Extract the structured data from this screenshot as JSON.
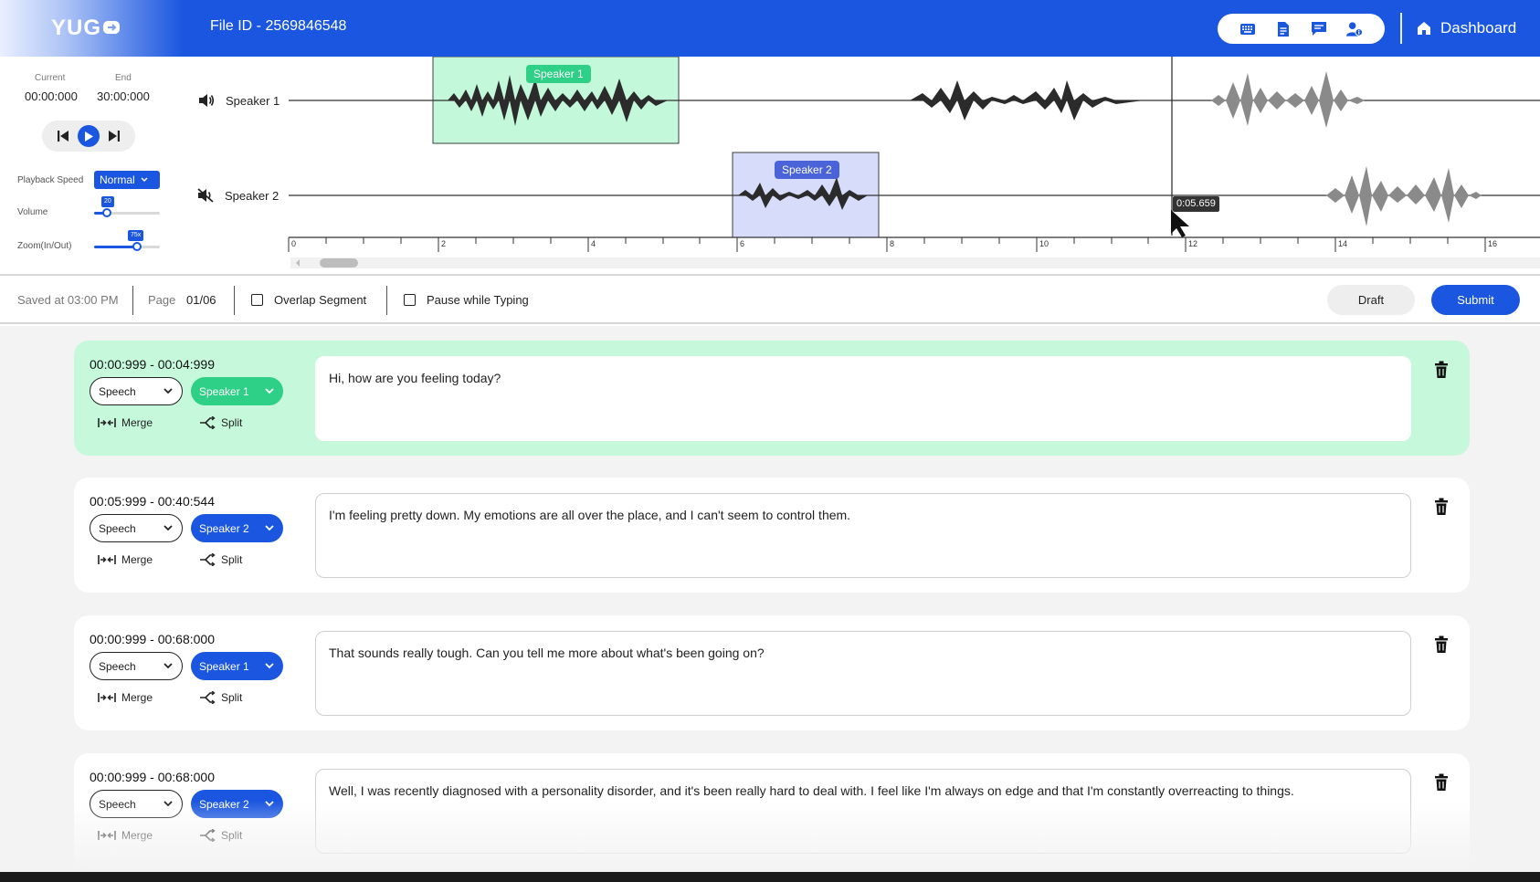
{
  "header": {
    "logo": "YUG",
    "file_id": "File ID - 2569846548",
    "icons": [
      "keyboard-icon",
      "document-icon",
      "comment-icon",
      "user-info-icon"
    ],
    "dashboard_label": "Dashboard"
  },
  "player": {
    "current_label": "Current",
    "current_value": "00:00:000",
    "end_label": "End",
    "end_value": "30:00:000",
    "playback_speed_label": "Playback Speed",
    "playback_speed_value": "Normal",
    "volume_label": "Volume",
    "volume_value": "20",
    "volume_level": 0.2,
    "zoom_label": "Zoom(In/Out)",
    "zoom_value": "75x",
    "zoom_level": 0.75
  },
  "waveform": {
    "speaker1_label": "Speaker 1",
    "speaker2_label": "Speaker 2",
    "speaker1_badge": "Speaker 1",
    "speaker2_badge": "Speaker 2",
    "cursor_time": "0:05.659",
    "ruler_labels": [
      "0",
      "2",
      "4",
      "6",
      "8",
      "10",
      "12",
      "14",
      "16"
    ]
  },
  "toolbar": {
    "saved_text": "Saved at 03:00 PM",
    "page_label": "Page",
    "page_value": "01/06",
    "overlap_label": "Overlap Segment",
    "pause_label": "Pause while Typing",
    "draft_label": "Draft",
    "submit_label": "Submit"
  },
  "colors": {
    "brand_blue": "#1a56e0",
    "speaker1_green": "#2ecf86",
    "segment_active_bg": "#c6f9dc",
    "speaker2_region": "#d6dcfa"
  },
  "segments": [
    {
      "time": "00:00:999  -  00:04:999",
      "type": "Speech",
      "speaker": "Speaker 1",
      "speaker_color": "#2ecf86",
      "merge_label": "Merge",
      "split_label": "Split",
      "text": "Hi, how are you feeling today?"
    },
    {
      "time": "00:05:999  -  00:40:544",
      "type": "Speech",
      "speaker": "Speaker 2",
      "speaker_color": "#1a56e0",
      "merge_label": "Merge",
      "split_label": "Split",
      "text": "I'm feeling pretty down. My emotions are all over the place, and I can't seem to control them."
    },
    {
      "time": "00:00:999  -  00:68:000",
      "type": "Speech",
      "speaker": "Speaker 1",
      "speaker_color": "#1a56e0",
      "merge_label": "Merge",
      "split_label": "Split",
      "text": "That sounds really tough. Can you tell me more about what's been going on?"
    },
    {
      "time": "00:00:999  -  00:68:000",
      "type": "Speech",
      "speaker": "Speaker 2",
      "speaker_color": "#1a56e0",
      "merge_label": "Merge",
      "split_label": "Split",
      "text": "Well, I was recently diagnosed with a personality disorder, and it's been really hard to deal with. I feel like I'm always on edge and that I'm constantly overreacting to things."
    }
  ]
}
